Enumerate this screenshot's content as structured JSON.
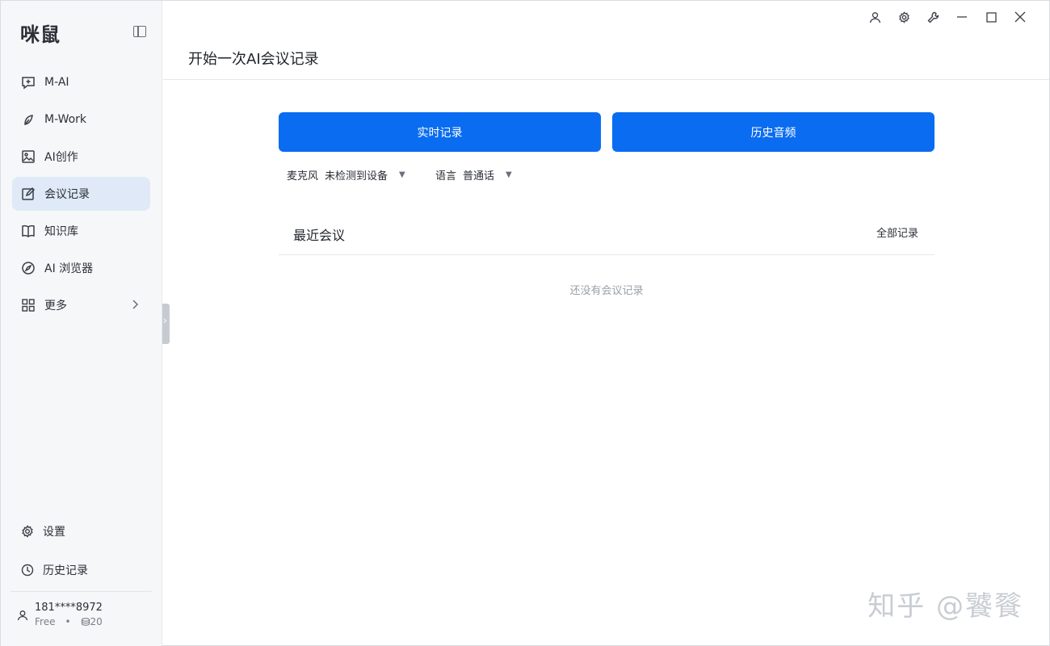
{
  "app": {
    "logo": "咪鼠"
  },
  "sidebar": {
    "items": [
      {
        "label": "M-AI",
        "icon": "chat-spark-icon"
      },
      {
        "label": "M-Work",
        "icon": "leaf-icon"
      },
      {
        "label": "AI创作",
        "icon": "image-icon"
      },
      {
        "label": "会议记录",
        "icon": "edit-note-icon",
        "active": true
      },
      {
        "label": "知识库",
        "icon": "book-icon"
      },
      {
        "label": "AI 浏览器",
        "icon": "compass-icon"
      },
      {
        "label": "更多",
        "icon": "grid-icon"
      }
    ],
    "settings_label": "设置",
    "history_label": "历史记录",
    "user": {
      "phone": "181****8972",
      "plan": "Free",
      "credits": "20"
    }
  },
  "header": {
    "title": "开始一次AI会议记录"
  },
  "main": {
    "live_button": "实时记录",
    "history_button": "历史音频",
    "mic": {
      "label": "麦克风",
      "value": "未检测到设备"
    },
    "language": {
      "label": "语言",
      "value": "普通话"
    },
    "recent_title": "最近会议",
    "all_records": "全部记录",
    "empty_text": "还没有会议记录"
  },
  "watermark": "知乎 @饕餮",
  "colors": {
    "primary": "#0a6cf0",
    "active_nav": "#dfe9f8",
    "sidebar_bg": "#f6f7f9"
  }
}
